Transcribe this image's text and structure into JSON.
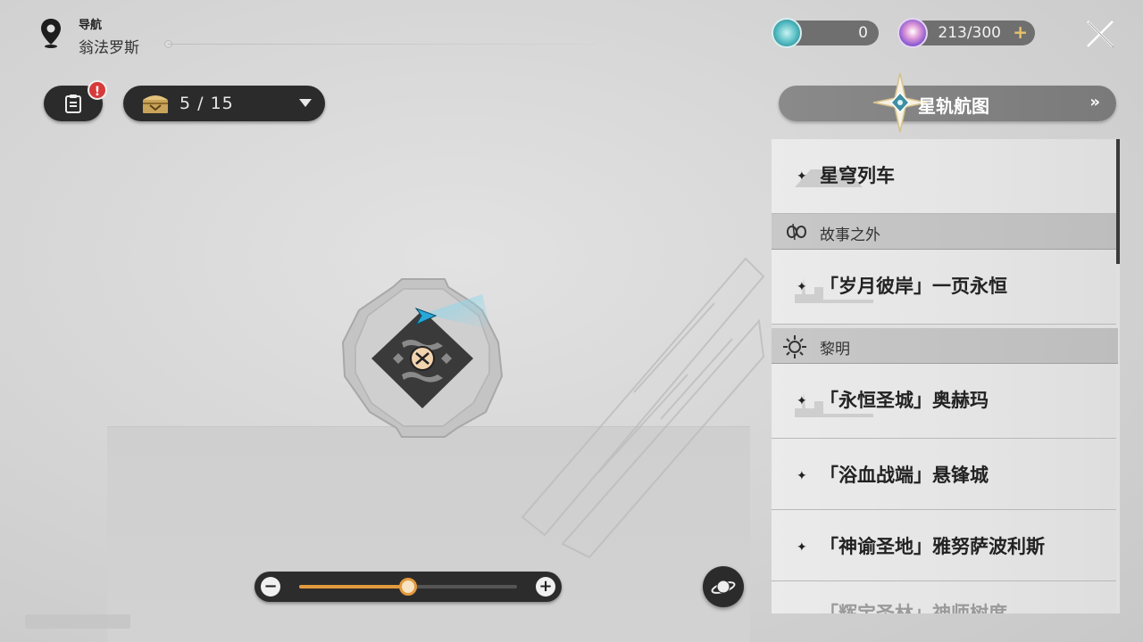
{
  "location": {
    "label": "导航",
    "name": "翁法罗斯"
  },
  "mission": {
    "badge": "!"
  },
  "chest": {
    "count": "5 / 15"
  },
  "currency": {
    "primary": {
      "value": "0",
      "icon": "jade-icon"
    },
    "secondary": {
      "value": "213/300",
      "plus": "+",
      "icon": "reserve-power-icon"
    }
  },
  "star_rail_map": {
    "label": "星轨航图",
    "arrow": "»"
  },
  "list": {
    "items": [
      {
        "type": "entry",
        "label": "星穹列车"
      },
      {
        "type": "category",
        "label": "故事之外"
      },
      {
        "type": "entry",
        "label": "「岁月彼岸」一页永恒"
      },
      {
        "type": "category",
        "label": "黎明"
      },
      {
        "type": "entry",
        "label": "「永恒圣城」奥赫玛"
      },
      {
        "type": "entry",
        "label": "「浴血战端」悬锋城"
      },
      {
        "type": "entry",
        "label": "「神谕圣地」雅努萨波利斯"
      },
      {
        "type": "entry",
        "label": "「辉宝圣林」神师树度"
      }
    ],
    "sparkle": "✦"
  },
  "zoom": {
    "minus": "−",
    "plus": "+",
    "level": 0.5
  },
  "colors": {
    "accent": "#e39a3e",
    "player": "#29a8d8",
    "alert": "#d73a3a"
  }
}
